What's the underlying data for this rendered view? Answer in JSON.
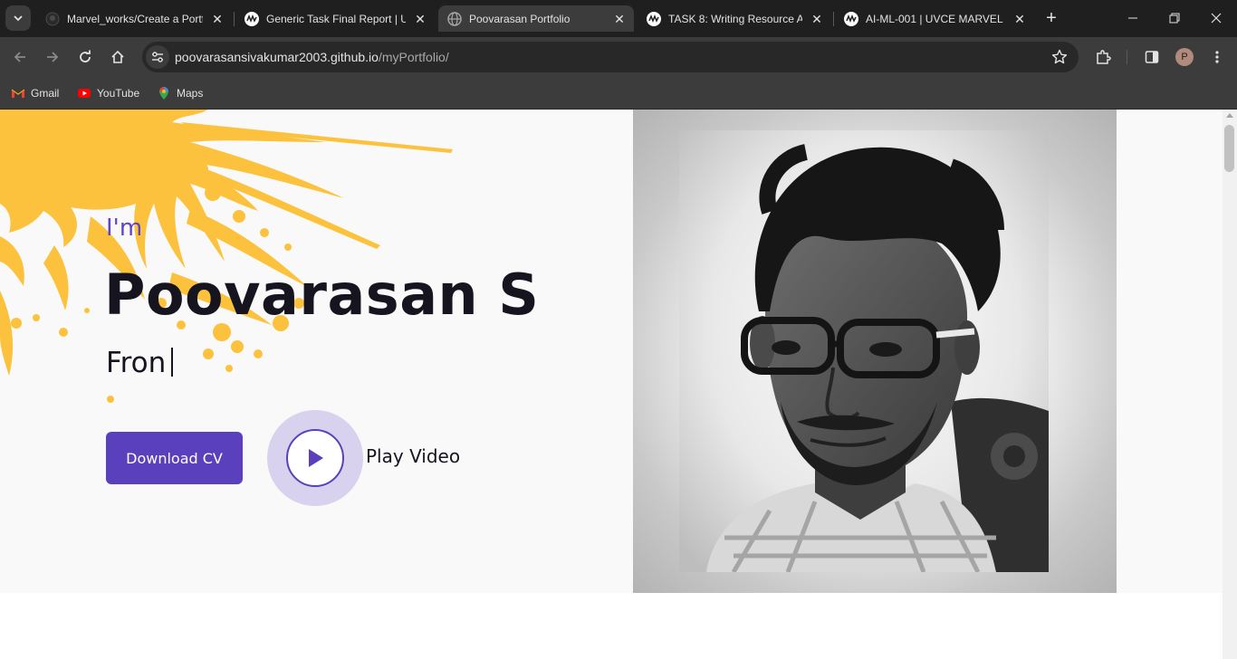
{
  "browser": {
    "tabs": [
      {
        "label": "Marvel_works/Create a Portfolio",
        "icon": "github-icon",
        "active": false
      },
      {
        "label": "Generic Task Final Report | UVCE MARVEL",
        "icon": "marvel-icon",
        "active": false
      },
      {
        "label": "Poovarasan Portfolio",
        "icon": "globe-icon",
        "active": true
      },
      {
        "label": "TASK 8: Writing Resource Articles",
        "icon": "marvel-icon",
        "active": false
      },
      {
        "label": "AI-ML-001 | UVCE MARVEL",
        "icon": "marvel-icon",
        "active": false
      }
    ],
    "url": {
      "host": "poovarasansivakumar2003.github.io",
      "path": "/myPortfolio/"
    },
    "profile_initial": "P",
    "bookmarks": [
      {
        "label": "Gmail",
        "icon": "gmail-icon"
      },
      {
        "label": "YouTube",
        "icon": "youtube-icon"
      },
      {
        "label": "Maps",
        "icon": "maps-icon"
      }
    ]
  },
  "hero": {
    "greeting": "I'm",
    "name": "Poovarasan S",
    "role_typed": "Fron",
    "download_cv_label": "Download CV",
    "play_video_label": "Play Video",
    "photo_alt": "Profile photo"
  },
  "colors": {
    "accent": "#5b40bd",
    "greeting": "#6045c2",
    "splash": "#fcc23d",
    "text": "#16141f",
    "hero_bg": "#f9f9f9"
  }
}
